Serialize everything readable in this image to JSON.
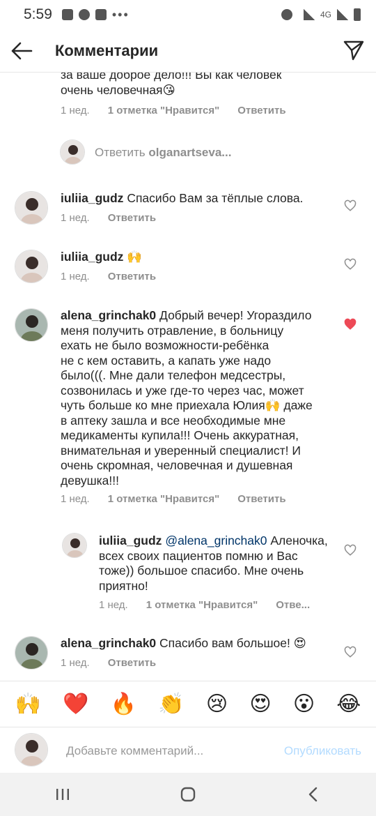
{
  "status": {
    "time": "5:59",
    "signal_label": "4G",
    "menu_dots": "•••"
  },
  "header": {
    "title": "Комментарии"
  },
  "comments": {
    "c0": {
      "text_line1": "за ваше доброе дело!!! Вы как человек",
      "text_line2": "очень человечная😘",
      "time": "1 нед.",
      "likes": "1 отметка \"Нравится\"",
      "reply": "Ответить"
    },
    "reply_prompt": {
      "label": "Ответить",
      "user": "olganartseva..."
    },
    "c1": {
      "user": "iuliia_gudz",
      "text": "Спасибо Вам за тёплые слова.",
      "time": "1 нед.",
      "reply": "Ответить"
    },
    "c2": {
      "user": "iuliia_gudz",
      "text": "🙌",
      "time": "1 нед.",
      "reply": "Ответить"
    },
    "c3": {
      "user": "alena_grinchak0",
      "lines": [
        "Добрый вечер! Угораздило",
        "меня получить отравление, в больницу",
        "ехать не было возможности-ребёнка",
        "не с кем  оставить, а капать уже надо",
        "было(((. Мне дали телефон медсестры,",
        "созвонилась и уже где-то через час, может",
        "чуть больше ко мне приехала Юлия🙌 даже",
        "в аптеку зашла и все необходимые мне",
        "медикаменты купила!!! Очень аккуратная,",
        "внимательная и уверенный специалист! И",
        "очень скромная, человечная и душевная",
        "девушка!!!"
      ],
      "time": "1 нед.",
      "likes": "1 отметка \"Нравится\"",
      "reply": "Ответить"
    },
    "c4": {
      "user": "iuliia_gudz",
      "mention": "@alena_grinchak0",
      "line1_rest": " Аленочка,",
      "lines": [
        "всех своих пациентов  помню и Вас",
        "тоже)) большое спасибо. Мне очень",
        "приятно!"
      ],
      "time": "1 нед.",
      "likes": "1 отметка \"Нравится\"",
      "reply": "Отве..."
    },
    "c5": {
      "user": "alena_grinchak0",
      "text": "Спасибо вам большое! 😍",
      "time": "1 нед.",
      "reply": "Ответить"
    }
  },
  "emoji_bar": [
    "🙌",
    "❤️",
    "🔥",
    "👏",
    "😢",
    "😍",
    "😮",
    "😂"
  ],
  "composer": {
    "placeholder": "Добавьте комментарий...",
    "publish": "Опубликовать"
  },
  "colors": {
    "liked_heart": "#ed4956",
    "link_blue": "#003569",
    "meta_gray": "#8e8e8e",
    "publish_disabled": "#b3dbff"
  }
}
